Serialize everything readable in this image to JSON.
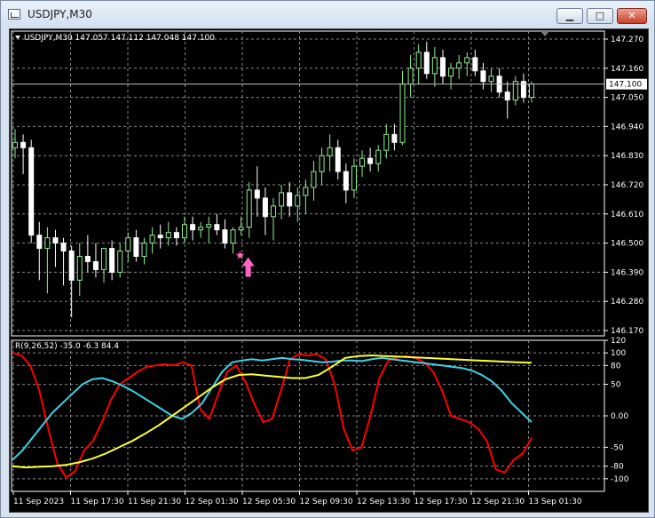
{
  "window": {
    "title": "USDJPY,M30",
    "min_label": "▁",
    "max_label": "□",
    "close_label": "✕"
  },
  "main_chart": {
    "header": "USDJPY,M30  147.057 147.112 147.048 147.100",
    "current_price": "147.100",
    "colors": {
      "bull": "#90ee90",
      "bear": "#ffffff",
      "axis": "#ffffff",
      "price_tag_bg": "#ffffff"
    }
  },
  "indicator": {
    "header": "R(9,26,52) -35.0 -6.3 84.4",
    "y_levels": [
      "120",
      "100",
      "80",
      "50",
      "0.00",
      "-50",
      "-80",
      "-100"
    ],
    "colors": {
      "line_fast": "#ff0000",
      "line_mid": "#3fd2e6",
      "line_slow": "#ffff33"
    }
  },
  "chart_data": [
    {
      "type": "candlestick",
      "title": "USDJPY,M30",
      "ylabel": "",
      "y_ticks": [
        "147.270",
        "147.160",
        "147.050",
        "146.940",
        "146.830",
        "146.720",
        "146.610",
        "146.500",
        "146.390",
        "146.280",
        "146.170"
      ],
      "ylim": [
        146.17,
        147.28
      ],
      "x_labels": [
        "11 Sep 2023",
        "11 Sep 17:30",
        "11 Sep 21:30",
        "12 Sep 01:30",
        "12 Sep 05:30",
        "12 Sep 09:30",
        "12 Sep 13:30",
        "12 Sep 17:30",
        "12 Sep 21:30",
        "13 Sep 01:30"
      ],
      "candles": [
        [
          146.86,
          146.93,
          146.82,
          146.88
        ],
        [
          146.88,
          146.91,
          146.76,
          146.86
        ],
        [
          146.86,
          146.89,
          146.5,
          146.53
        ],
        [
          146.53,
          146.58,
          146.36,
          146.48
        ],
        [
          146.48,
          146.56,
          146.31,
          146.52
        ],
        [
          146.52,
          146.55,
          146.41,
          146.5
        ],
        [
          146.5,
          146.52,
          146.34,
          146.47
        ],
        [
          146.47,
          146.49,
          146.22,
          146.36
        ],
        [
          146.36,
          146.5,
          146.3,
          146.45
        ],
        [
          146.45,
          146.53,
          146.39,
          146.43
        ],
        [
          146.43,
          146.5,
          146.37,
          146.4
        ],
        [
          146.4,
          146.46,
          146.35,
          146.48
        ],
        [
          146.48,
          146.51,
          146.36,
          146.39
        ],
        [
          146.39,
          146.5,
          146.37,
          146.47
        ],
        [
          146.47,
          146.54,
          146.43,
          146.52
        ],
        [
          146.52,
          146.55,
          146.43,
          146.45
        ],
        [
          146.45,
          146.52,
          146.42,
          146.5
        ],
        [
          146.5,
          146.56,
          146.46,
          146.53
        ],
        [
          146.53,
          146.57,
          146.48,
          146.52
        ],
        [
          146.52,
          146.58,
          146.49,
          146.54
        ],
        [
          146.54,
          146.56,
          146.49,
          146.52
        ],
        [
          146.52,
          146.6,
          146.5,
          146.57
        ],
        [
          146.57,
          146.6,
          146.51,
          146.55
        ],
        [
          146.55,
          146.58,
          146.52,
          146.56
        ],
        [
          146.56,
          146.6,
          146.5,
          146.57
        ],
        [
          146.57,
          146.61,
          146.53,
          146.55
        ],
        [
          146.55,
          146.59,
          146.48,
          146.5
        ],
        [
          146.5,
          146.56,
          146.46,
          146.55
        ],
        [
          146.55,
          146.6,
          146.53,
          146.56
        ],
        [
          146.56,
          146.73,
          146.52,
          146.7
        ],
        [
          146.7,
          146.79,
          146.6,
          146.67
        ],
        [
          146.67,
          146.71,
          146.53,
          146.6
        ],
        [
          146.6,
          146.67,
          146.51,
          146.64
        ],
        [
          146.64,
          146.72,
          146.59,
          146.69
        ],
        [
          146.69,
          146.73,
          146.6,
          146.64
        ],
        [
          146.64,
          146.71,
          146.58,
          146.68
        ],
        [
          146.68,
          146.74,
          146.61,
          146.71
        ],
        [
          146.71,
          146.81,
          146.66,
          146.77
        ],
        [
          146.77,
          146.86,
          146.72,
          146.83
        ],
        [
          146.83,
          146.91,
          146.77,
          146.86
        ],
        [
          146.86,
          146.89,
          146.74,
          146.77
        ],
        [
          146.77,
          146.8,
          146.65,
          146.7
        ],
        [
          146.7,
          146.82,
          146.67,
          146.79
        ],
        [
          146.79,
          146.85,
          146.75,
          146.82
        ],
        [
          146.82,
          146.86,
          146.77,
          146.8
        ],
        [
          146.8,
          146.87,
          146.77,
          146.85
        ],
        [
          146.85,
          146.95,
          146.82,
          146.91
        ],
        [
          146.91,
          146.95,
          146.85,
          146.88
        ],
        [
          146.88,
          147.15,
          146.87,
          147.1
        ],
        [
          147.1,
          147.21,
          147.05,
          147.16
        ],
        [
          147.16,
          147.25,
          147.1,
          147.22
        ],
        [
          147.22,
          147.26,
          147.12,
          147.14
        ],
        [
          147.14,
          147.24,
          147.09,
          147.2
        ],
        [
          147.2,
          147.23,
          147.1,
          147.13
        ],
        [
          147.13,
          147.18,
          147.08,
          147.16
        ],
        [
          147.16,
          147.21,
          147.12,
          147.18
        ],
        [
          147.18,
          147.22,
          147.13,
          147.2
        ],
        [
          147.2,
          147.23,
          147.13,
          147.15
        ],
        [
          147.15,
          147.18,
          147.08,
          147.11
        ],
        [
          147.11,
          147.16,
          147.07,
          147.13
        ],
        [
          147.13,
          147.16,
          147.05,
          147.07
        ],
        [
          147.07,
          147.11,
          146.97,
          147.04
        ],
        [
          147.04,
          147.13,
          147.02,
          147.11
        ],
        [
          147.11,
          147.14,
          147.03,
          147.05
        ],
        [
          147.05,
          147.11,
          147.03,
          147.1
        ]
      ]
    },
    {
      "type": "line",
      "title": "R(9,26,52)",
      "ylim": [
        -120,
        120
      ],
      "series": [
        {
          "name": "-35.0",
          "values": [
            100,
            96,
            80,
            40,
            -20,
            -75,
            -98,
            -88,
            -55,
            -40,
            -10,
            25,
            50,
            60,
            70,
            78,
            80,
            82,
            80,
            85,
            80,
            10,
            -5,
            35,
            70,
            80,
            55,
            20,
            -10,
            -5,
            40,
            90,
            98,
            96,
            98,
            90,
            50,
            -20,
            -55,
            -50,
            0,
            60,
            88,
            93,
            95,
            92,
            85,
            70,
            40,
            0,
            -5,
            -10,
            -20,
            -40,
            -85,
            -90,
            -70,
            -60,
            -35
          ]
        },
        {
          "name": "-6.3",
          "values": [
            -70,
            -55,
            -35,
            -15,
            5,
            20,
            35,
            50,
            58,
            60,
            55,
            48,
            40,
            30,
            20,
            10,
            0,
            -5,
            5,
            20,
            45,
            70,
            85,
            88,
            90,
            88,
            90,
            92,
            90,
            89,
            87,
            85,
            86,
            88,
            88,
            87,
            90,
            92,
            90,
            88,
            86,
            84,
            82,
            80,
            78,
            76,
            72,
            65,
            55,
            40,
            20,
            5,
            -10
          ]
        },
        {
          "name": "84.4",
          "values": [
            -80,
            -82,
            -81,
            -80,
            -78,
            -74,
            -68,
            -60,
            -50,
            -40,
            -28,
            -15,
            0,
            15,
            30,
            45,
            58,
            65,
            66,
            64,
            62,
            60,
            60,
            65,
            78,
            92,
            95,
            96,
            95,
            94,
            93,
            92,
            91,
            90,
            89,
            88,
            87,
            86,
            85,
            84.4
          ]
        }
      ]
    }
  ]
}
